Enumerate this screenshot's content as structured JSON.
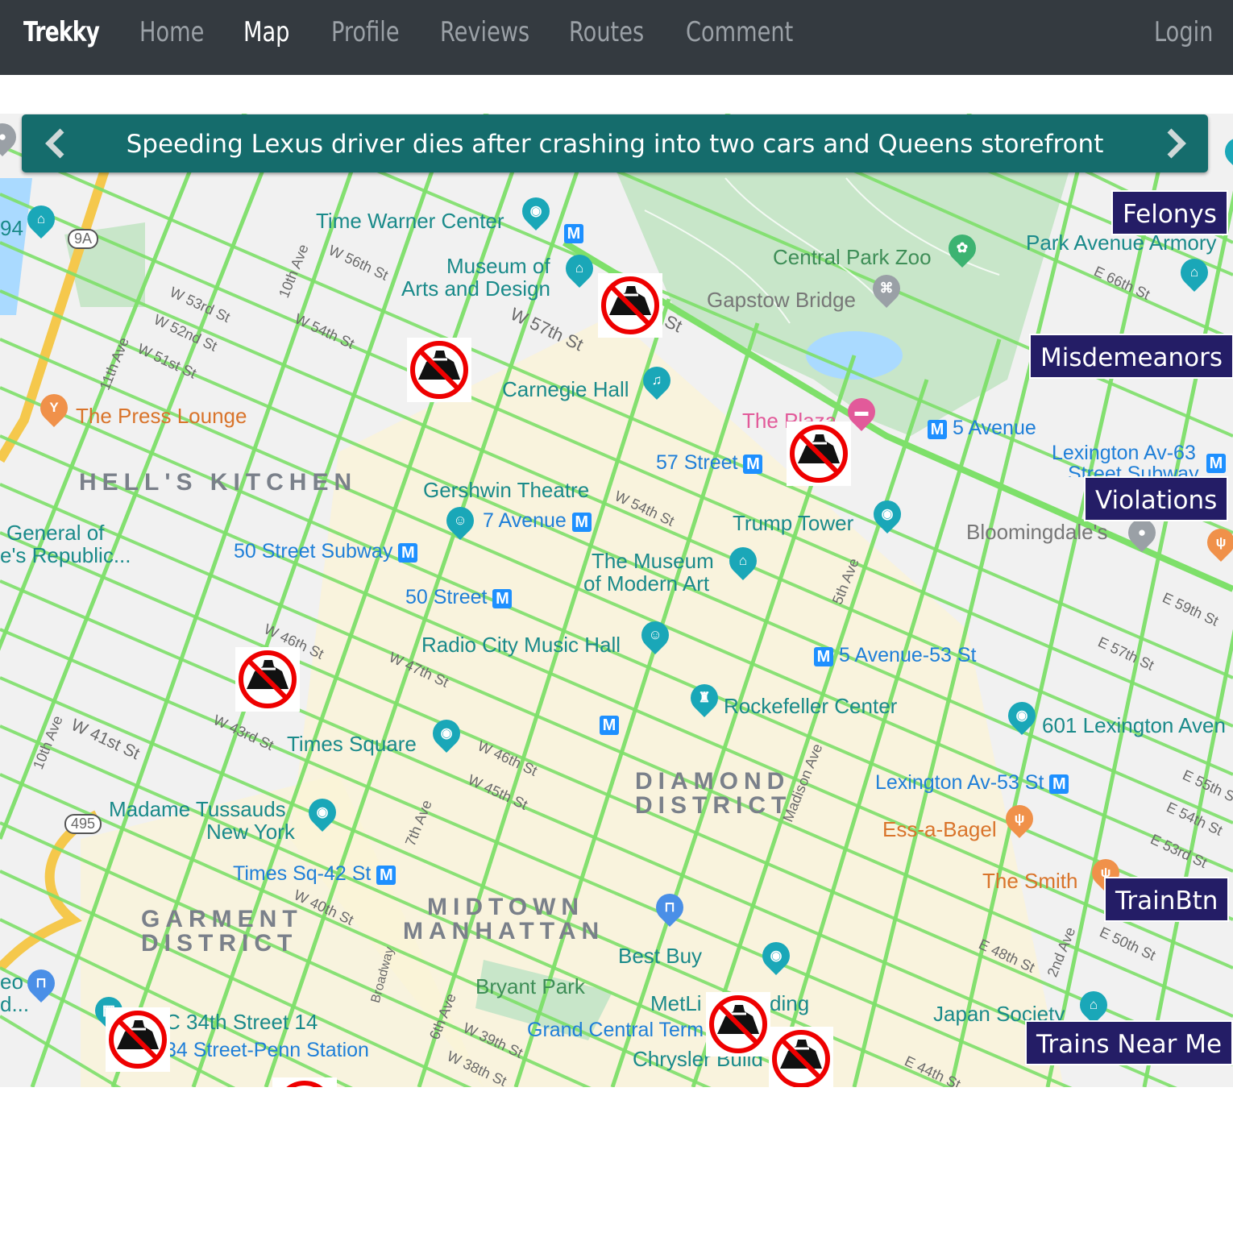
{
  "navbar": {
    "brand": "Trekky",
    "links": [
      "Home",
      "Map",
      "Profile",
      "Reviews",
      "Routes",
      "Comment"
    ],
    "active": "Map",
    "login": "Login"
  },
  "banner": {
    "headline": "Speeding Lexus driver dies after crashing into two cars and Queens storefront"
  },
  "controls": {
    "felonys": "Felonys",
    "misdemeanors": "Misdemeanors",
    "violations": "Violations",
    "train_btn": "TrainBtn",
    "trains_near_me": "Trains Near Me"
  },
  "map": {
    "places": {
      "time_warner": "Time Warner Center",
      "museum_arts_1": "Museum of",
      "museum_arts_2": "Arts and Design",
      "central_park_zoo": "Central Park Zoo",
      "park_avenue_armory": "Park Avenue Armory",
      "gapstow": "Gapstow Bridge",
      "carnegie": "Carnegie Hall",
      "plaza": "The Plaza",
      "five_avenue": "5 Avenue",
      "lexington_63_1": "Lexington Av-63",
      "lexington_63_2": "Street Subway",
      "press_lounge": "The Press Lounge",
      "st57": "57 Street",
      "gershwin": "Gershwin Theatre",
      "seven_avenue": "7 Avenue",
      "trump_tower": "Trump Tower",
      "bloomingdales": "Bloomingdale's",
      "general_1": "General of",
      "general_2": "e's Republic...",
      "st50_subway": "50 Street Subway",
      "moma_1": "The Museum",
      "moma_2": "of Modern Art",
      "st50": "50 Street",
      "radio_city": "Radio City Music Hall",
      "ave5_53": "5 Avenue-53 St",
      "rockefeller": "Rockefeller Center",
      "lex601": "601 Lexington Aven",
      "times_square": "Times Square",
      "lexington_53": "Lexington Av-53 St",
      "madame_1": "Madame Tussauds",
      "madame_2": "New York",
      "ess_a_bagel": "Ess-a-Bagel",
      "times_sq_42": "Times Sq-42 St",
      "the_smith": "The Smith",
      "best_buy": "Best Buy",
      "bryant_park": "Bryant Park",
      "metlife_1": "MetLi",
      "metlife_2": "ding",
      "japan_society": "Japan Society",
      "st34": "C 34th Street 14",
      "penn": "34 Street-Penn Station",
      "grand_central": "Grand Central Term",
      "chrysler": "Chrysler Build",
      "leo_1": "eo",
      "leo_2": "d...",
      "num94": "94"
    },
    "districts": {
      "hells_kitchen": "HELL'S KITCHEN",
      "diamond_1": "DIAMOND",
      "diamond_2": "DISTRICT",
      "garment_1": "GARMENT",
      "garment_2": "DISTRICT",
      "midtown_1": "MIDTOWN",
      "midtown_2": "MANHATTAN"
    },
    "streets": {
      "w56": "W 56th St",
      "w57": "W 57th St",
      "w53": "W 53rd St",
      "w52": "W 52nd St",
      "w51": "W 51st St",
      "w54a": "W 54th St",
      "w54b": "W 54th St",
      "ave10": "10th Ave",
      "ave11": "11th Ave",
      "e66": "E 66th St",
      "e59": "E 59th St",
      "e57": "E 57th St",
      "ave5": "5th Ave",
      "w46a": "W 46th St",
      "w47": "W 47th St",
      "w43": "W 43rd St",
      "w46b": "W 46th St",
      "w45": "W 45th St",
      "ave10b": "10th Ave",
      "w41": "W 41st St",
      "madison": "Madison Ave",
      "e55": "E 55th St",
      "e54": "E 54th St",
      "e53": "E 53rd St",
      "w40": "W 40th St",
      "ave7": "7th Ave",
      "broadway": "Broadway",
      "e50": "E 50th St",
      "e48": "E 48th St",
      "ave2": "2nd Ave",
      "ave6": "6th Ave",
      "w39": "W 39th St",
      "w38": "W 38th St",
      "e44": "E 44th St",
      "st57_frag": "St",
      "hw9a": "9A",
      "hw495": "495"
    }
  }
}
